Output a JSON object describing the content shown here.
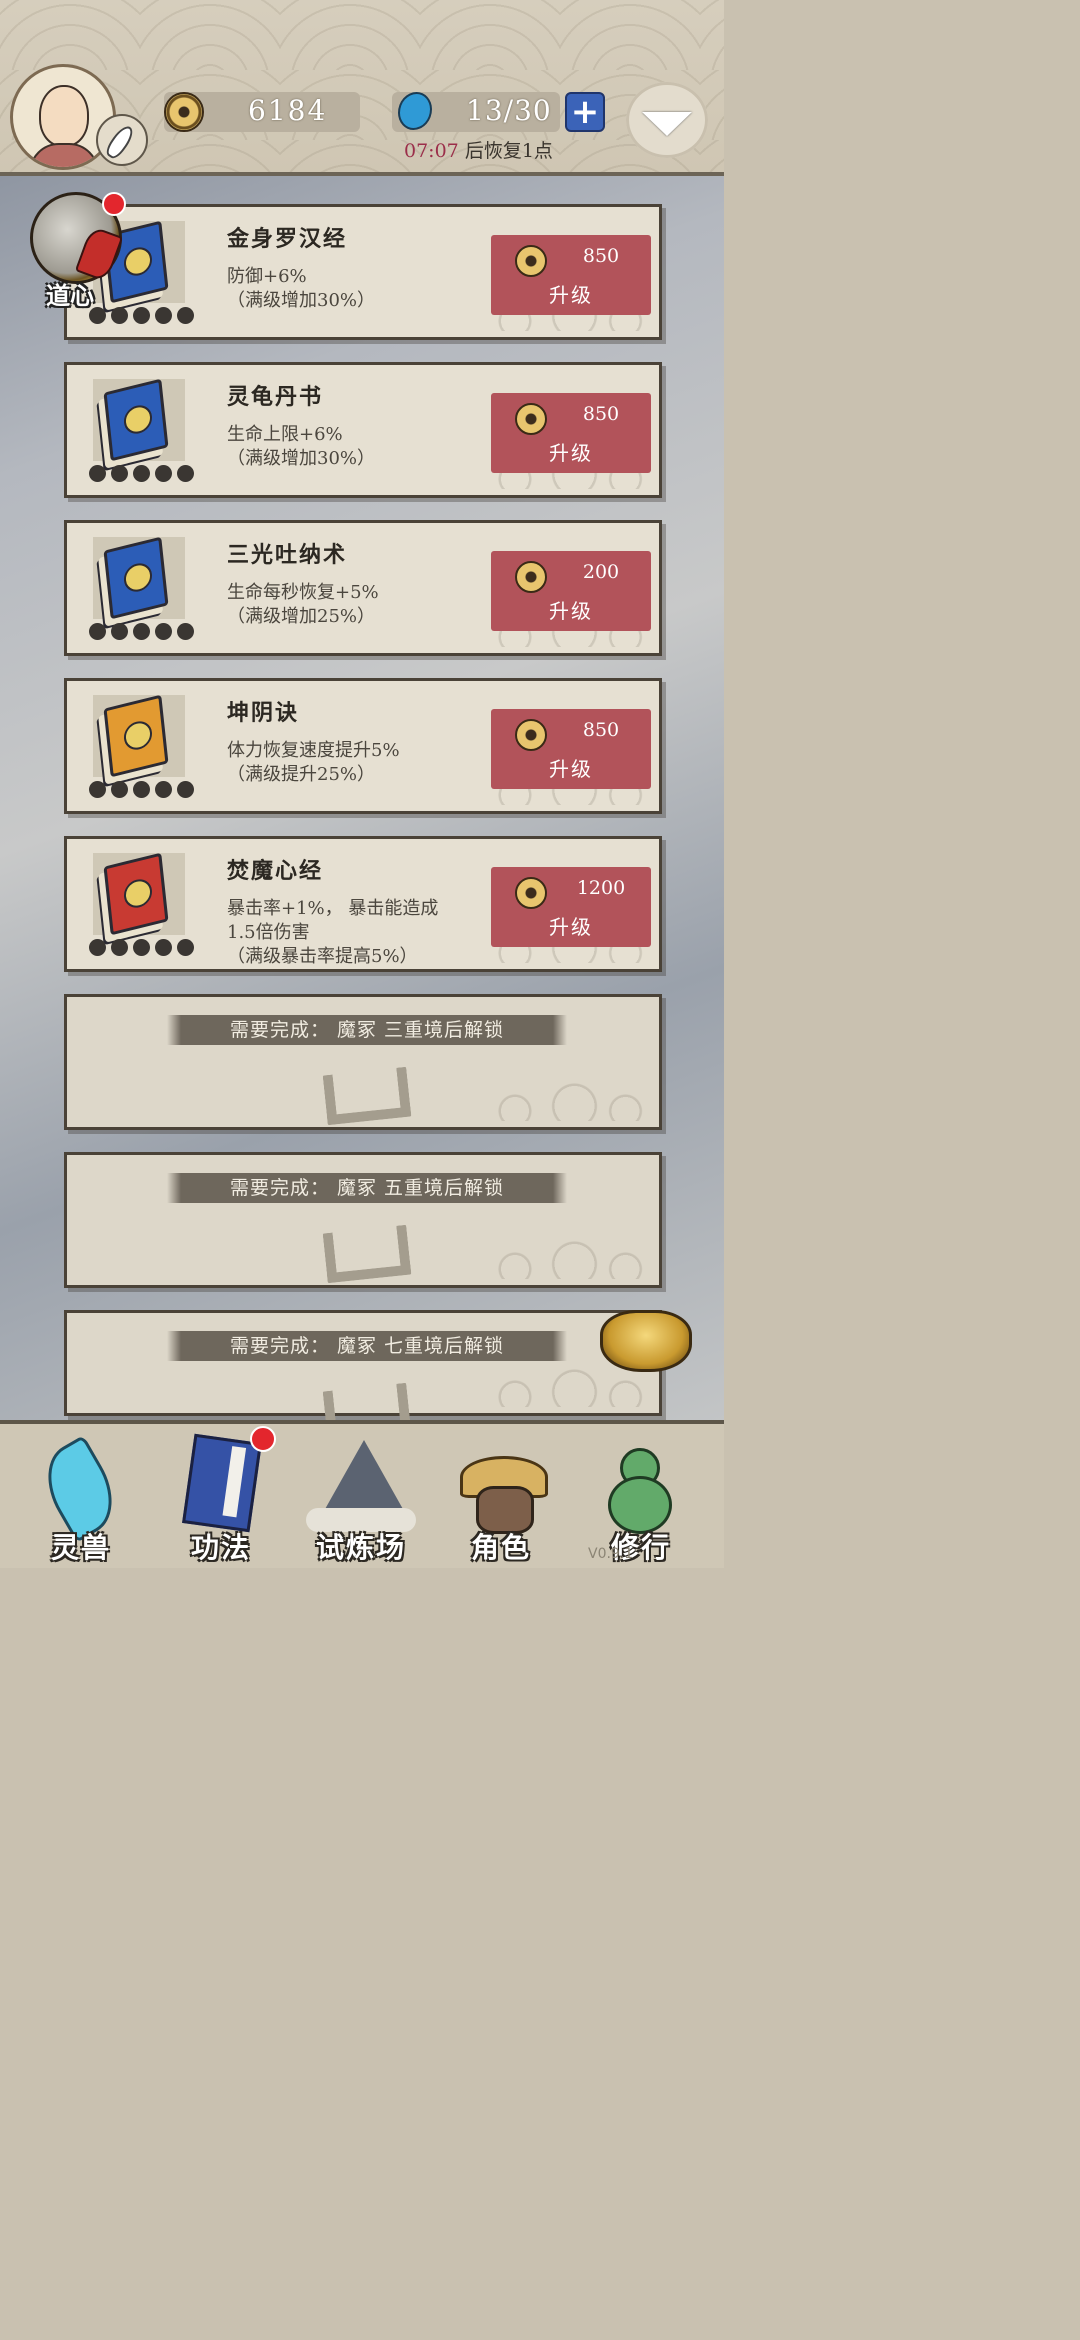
{
  "header": {
    "coins": "6184",
    "energy": "13/30",
    "recover_time": "07:07",
    "recover_suffix": "后恢复1点"
  },
  "daoxin_label": "道心",
  "colors": {
    "upgrade_button": "#b2535a",
    "energy_plus": "#3b63b8",
    "notice_badge": "#e3262d"
  },
  "skills": [
    {
      "name": "金身罗汉经",
      "desc": [
        "防御+6%",
        "（满级增加30%）"
      ],
      "cost": "850",
      "action": "升级",
      "book_color": "#2c5db7",
      "icon": "blue-book-icon"
    },
    {
      "name": "灵龟丹书",
      "desc": [
        "生命上限+6%",
        "（满级增加30%）"
      ],
      "cost": "850",
      "action": "升级",
      "book_color": "#2c5db7",
      "icon": "blue-book-icon"
    },
    {
      "name": "三光吐纳术",
      "desc": [
        "生命每秒恢复+5%",
        "（满级增加25%）"
      ],
      "cost": "200",
      "action": "升级",
      "book_color": "#2c5db7",
      "icon": "blue-book-cross-icon"
    },
    {
      "name": "坤阴诀",
      "desc": [
        "体力恢复速度提升5%",
        "（满级提升25%）"
      ],
      "cost": "850",
      "action": "升级",
      "book_color": "#e29a31",
      "icon": "orange-book-icon"
    },
    {
      "name": "焚魔心经",
      "desc": [
        "暴击率+1%， 暴击能造成",
        "1.5倍伤害",
        "（满级暴击率提高5%）"
      ],
      "cost": "1200",
      "action": "升级",
      "book_color": "#c83a32",
      "icon": "red-book-icon"
    }
  ],
  "locked": [
    {
      "text": "需要完成： 魔冢 三重境后解锁"
    },
    {
      "text": "需要完成： 魔冢 五重境后解锁"
    },
    {
      "text": "需要完成： 魔冢 七重境后解锁"
    }
  ],
  "nav": [
    {
      "label": "灵兽",
      "icon": "feather-icon"
    },
    {
      "label": "功法",
      "icon": "book-icon"
    },
    {
      "label": "试炼场",
      "icon": "mountain-icon"
    },
    {
      "label": "角色",
      "icon": "character-icon"
    },
    {
      "label": "修行",
      "icon": "gourd-icon"
    }
  ],
  "version": "V0.9.1"
}
